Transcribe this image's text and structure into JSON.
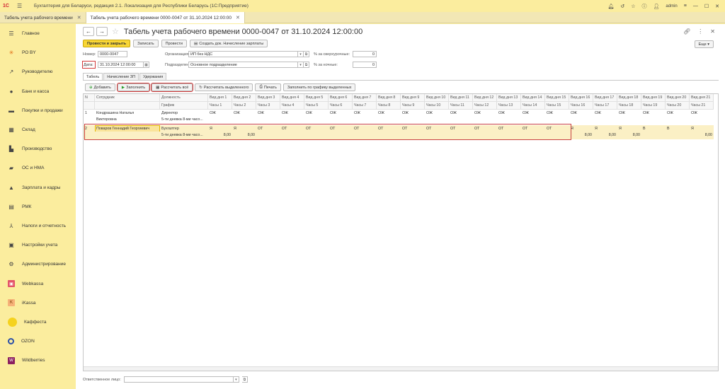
{
  "titlebar": {
    "logo": "1С",
    "app_title": "Бухгалтерия для Беларуси, редакция 2.1. Локализация для Республики Беларусь   (1С:Предприятие)",
    "user": "admin"
  },
  "tabs": [
    {
      "label": "Табель учета рабочего времени"
    },
    {
      "label": "Табель учета рабочего времени 0000-0047 от 31.10.2024 12:00:00"
    }
  ],
  "sidebar": {
    "items": [
      {
        "label": "Главное",
        "icon": "menu-icon"
      },
      {
        "label": "РО BY",
        "icon": "sun-icon"
      },
      {
        "label": "Руководителю",
        "icon": "chart-icon"
      },
      {
        "label": "Банк и касса",
        "icon": "bank-icon"
      },
      {
        "label": "Покупки и продажи",
        "icon": "cart-icon"
      },
      {
        "label": "Склад",
        "icon": "warehouse-icon"
      },
      {
        "label": "Производство",
        "icon": "factory-icon"
      },
      {
        "label": "ОС и НМА",
        "icon": "truck-icon"
      },
      {
        "label": "Зарплата и кадры",
        "icon": "people-icon"
      },
      {
        "label": "РМК",
        "icon": "cash-register-icon"
      },
      {
        "label": "Налоги и отчетность",
        "icon": "tax-icon"
      },
      {
        "label": "Настройки учета",
        "icon": "settings-icon"
      },
      {
        "label": "Администрирование",
        "icon": "gear-icon"
      },
      {
        "label": "Webkassa",
        "icon": "webkassa-icon"
      },
      {
        "label": "iKassa",
        "icon": "ikassa-icon"
      },
      {
        "label": "Каффеста",
        "icon": "kaffesta-icon"
      },
      {
        "label": "OZON",
        "icon": "ozon-icon"
      },
      {
        "label": "Wildberries",
        "icon": "wildberries-icon"
      }
    ]
  },
  "document": {
    "title": "Табель учета рабочего времени 0000-0047 от 31.10.2024 12:00:00",
    "more_label": "Еще ▾",
    "commands": {
      "post_close": "Провести и закрыть",
      "save": "Записать",
      "post": "Провести",
      "create_based": "Создать док. Начисление зарплаты"
    },
    "fields": {
      "number_label": "Номер:",
      "number_value": "0000-0047",
      "date_label": "Дата:",
      "date_value": "31.10.2024 12:00:00",
      "org_label": "Организация:",
      "org_value": "ИП без НДС",
      "dept_label": "Подразделение:",
      "dept_value": "Основное подразделение",
      "overtime_label": "% за сверхурочные:",
      "overtime_value": "0",
      "night_label": "% за ночные:",
      "night_value": "0"
    },
    "form_tabs": [
      "Табель",
      "Начисление ЗП",
      "Удержания"
    ],
    "table_buttons": {
      "add": "Добавить",
      "fill": "Заполнить",
      "calc_all": "Рассчитать всё",
      "calc_selected": "Рассчитать выделенного",
      "print": "Печать",
      "fill_schedule": "Заполнить по графику выделенных"
    },
    "table": {
      "header_n": "N",
      "header_employee": "Сотрудник",
      "header_position": "Должность",
      "header_schedule": "График",
      "day_type_headers": [
        "Вид дня 1",
        "Вид дня 2",
        "Вид дня 3",
        "Вид дня 4",
        "Вид дня 5",
        "Вид дня 6",
        "Вид дня 7",
        "Вид дня 8",
        "Вид дня 9",
        "Вид дня 10",
        "Вид дня 11",
        "Вид дня 12",
        "Вид дня 13",
        "Вид дня 14",
        "Вид дня 15",
        "Вид дня 16",
        "Вид дня 17",
        "Вид дня 18",
        "Вид дня 19",
        "Вид дня 20",
        "Вид дня 21"
      ],
      "hours_headers": [
        "Часы 1",
        "Часы 2",
        "Часы 3",
        "Часы 4",
        "Часы 5",
        "Часы 6",
        "Часы 7",
        "Часы 8",
        "Часы 9",
        "Часы 10",
        "Часы 11",
        "Часы 12",
        "Часы 13",
        "Часы 14",
        "Часы 15",
        "Часы 16",
        "Часы 17",
        "Часы 18",
        "Часы 19",
        "Часы 20",
        "Часы 21"
      ],
      "rows": [
        {
          "n": "1",
          "employee": "Кондрашина Наталья",
          "employee_line2": "Викторовна",
          "position": "Директор",
          "schedule": "5-ти дневка 8-ми часо...",
          "day_types": [
            "ОЖ",
            "ОЖ",
            "ОЖ",
            "ОЖ",
            "ОЖ",
            "ОЖ",
            "ОЖ",
            "ОЖ",
            "ОЖ",
            "ОЖ",
            "ОЖ",
            "ОЖ",
            "ОЖ",
            "ОЖ",
            "ОЖ",
            "ОЖ",
            "ОЖ",
            "ОЖ",
            "ОЖ",
            "ОЖ",
            "ОЖ"
          ],
          "hours": [
            "",
            "",
            "",
            "",
            "",
            "",
            "",
            "",
            "",
            "",
            "",
            "",
            "",
            "",
            "",
            "",
            "",
            "",
            "",
            "",
            ""
          ]
        },
        {
          "n": "2",
          "employee": "Поваров Геннадий Георгиевич",
          "employee_line2": "",
          "position": "Бухгалтер",
          "schedule": "5-ти дневка 8-ми часо...",
          "day_types": [
            "Я",
            "Я",
            "ОТ",
            "ОТ",
            "ОТ",
            "ОТ",
            "ОТ",
            "ОТ",
            "ОТ",
            "ОТ",
            "ОТ",
            "ОТ",
            "ОТ",
            "ОТ",
            "ОТ",
            "Я",
            "Я",
            "Я",
            "В",
            "В",
            "Я"
          ],
          "hours": [
            "8,00",
            "8,00",
            "",
            "",
            "",
            "",
            "",
            "",
            "",
            "",
            "",
            "",
            "",
            "",
            "",
            "8,00",
            "8,00",
            "8,00",
            "",
            "",
            "8,00"
          ]
        }
      ]
    },
    "footer": {
      "responsible_label": "Ответственное лицо:",
      "responsible_value": ""
    }
  },
  "colors": {
    "sidebar_bg": "#fbed9e",
    "primary_button": "#f8d635",
    "highlight_border": "#c94040"
  }
}
